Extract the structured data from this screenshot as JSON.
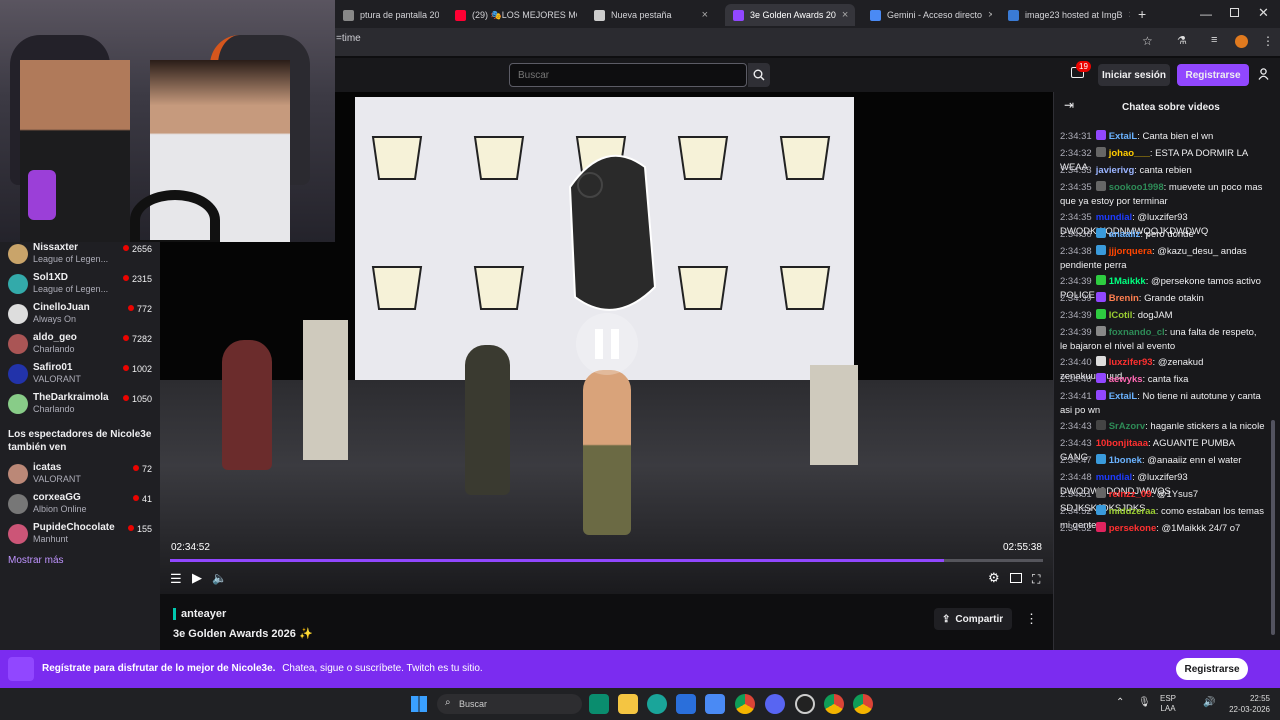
{
  "browser": {
    "tabs": [
      {
        "label": "ptura de pantalla 2026",
        "color": "#888"
      },
      {
        "label": "(29) 🎭LOS MEJORES MC",
        "color": "#ff0033"
      },
      {
        "label": "Nueva pestaña",
        "color": "#cccccc"
      },
      {
        "label": "3e Golden Awards 20",
        "color": "#9147ff"
      },
      {
        "label": "Gemini - Acceso directo",
        "color": "#4a8af4"
      },
      {
        "label": "image23 hosted at ImgB",
        "color": "#3a7bd5"
      }
    ],
    "address": "=time"
  },
  "header": {
    "search_placeholder": "Buscar",
    "notif_count": "19",
    "login_label": "Iniciar sesión",
    "signup_label": "Registrarse"
  },
  "sidebar": {
    "channels": [
      {
        "name": "Nissaxter",
        "game": "League of Legen...",
        "viewers": "2656",
        "color": "#c9a46a"
      },
      {
        "name": "Sol1XD",
        "game": "League of Legen...",
        "viewers": "2315",
        "color": "#3aa"
      },
      {
        "name": "CinelloJuan",
        "game": "Always On",
        "viewers": "772",
        "color": "#ddd"
      },
      {
        "name": "aldo_geo",
        "game": "Charlando",
        "viewers": "7282",
        "color": "#a55"
      },
      {
        "name": "Safiro01",
        "game": "VALORANT",
        "viewers": "1002",
        "color": "#2233aa"
      },
      {
        "name": "TheDarkraimola",
        "game": "Charlando",
        "viewers": "1050",
        "color": "#8c8"
      }
    ],
    "also_watch_title": "Los espectadores de Nicole3e también ven",
    "also_watch": [
      {
        "name": "icatas",
        "game": "VALORANT",
        "viewers": "72",
        "color": "#b87"
      },
      {
        "name": "corxeaGG",
        "game": "Albion Online",
        "viewers": "41",
        "color": "#777"
      },
      {
        "name": "PupideChocolate",
        "game": "Manhunt",
        "viewers": "155",
        "color": "#c57"
      }
    ],
    "show_more": "Mostrar más"
  },
  "player": {
    "time_current": "02:34:52",
    "time_total": "02:55:38",
    "progress": 0.887
  },
  "info": {
    "channel": "anteayer",
    "title": "3e Golden Awards 2026 ✨",
    "share_label": "Compartir"
  },
  "chat": {
    "title": "Chatea sobre videos",
    "messages": [
      {
        "time": "2:34:31",
        "user": "ExtaiL",
        "color": "#6bb3ff",
        "badge": "#9147ff",
        "text": "Canta bien el wn"
      },
      {
        "time": "2:34:32",
        "user": "johao___",
        "color": "#ffcc00",
        "badge": "#666",
        "text": "ESTA PA DORMIR LA WEAA"
      },
      {
        "time": "2:34:33",
        "user": "javierivg",
        "color": "#9ab4ff",
        "badge": "",
        "text": "canta rebien"
      },
      {
        "time": "2:34:35",
        "user": "sookoo1998",
        "color": "#2e8b57",
        "badge": "#666",
        "text": "muevete un poco mas que ya estoy por terminar"
      },
      {
        "time": "2:34:35",
        "user": "mundial",
        "color": "#1e3cff",
        "badge": "",
        "text": "@luxzifer93 DWQDKWQDNMWQOJKDWDWQ"
      },
      {
        "time": "2:34:36",
        "user": "anaaiiz",
        "color": "#6bb3ff",
        "badge": "#3a9bdc",
        "text": "pero donde"
      },
      {
        "time": "2:34:38",
        "user": "jjjorquera",
        "color": "#ff4500",
        "badge": "#3a9bdc",
        "text": "@kazu_desu_ andas pendiente perra"
      },
      {
        "time": "2:34:39",
        "user": "1Maikkk",
        "color": "#00ff7f",
        "badge": "#2ecc40",
        "text": "@persekone tamos activo POLICE"
      },
      {
        "time": "2:34:39",
        "user": "Brenin",
        "color": "#ff7f50",
        "badge": "#9147ff",
        "text": "Grande otakin"
      },
      {
        "time": "2:34:39",
        "user": "ICotil",
        "color": "#9acd32",
        "badge": "#2ecc40",
        "text": "dogJAM"
      },
      {
        "time": "2:34:39",
        "user": "foxnando_cl",
        "color": "#2e8b57",
        "badge": "#888",
        "text": "una falta de respeto, le bajaron el nivel al evento"
      },
      {
        "time": "2:34:40",
        "user": "luxzifer93",
        "color": "#ff3030",
        "badge": "#ddd",
        "text": "@zenakud zenakuuuuuud"
      },
      {
        "time": "2:34:40",
        "user": "aewyks",
        "color": "#ff69b4",
        "badge": "#9147ff",
        "text": "canta fixa"
      },
      {
        "time": "2:34:41",
        "user": "ExtaiL",
        "color": "#6bb3ff",
        "badge": "#9147ff",
        "text": "No tiene ni autotune y canta asi po wn"
      },
      {
        "time": "2:34:43",
        "user": "SrAzorv",
        "color": "#2e8b57",
        "badge": "#444",
        "text": "haganle stickers a la nicole"
      },
      {
        "time": "2:34:43",
        "user": "10bonjitaaa",
        "color": "#ff3030",
        "badge": "",
        "text": "AGUANTE PUMBA GANG"
      },
      {
        "time": "2:34:47",
        "user": "1bonek",
        "color": "#6bb3ff",
        "badge": "#3a9bdc",
        "text": "@anaaiiz enn el water"
      },
      {
        "time": "2:34:48",
        "user": "mundial",
        "color": "#1e3cff",
        "badge": "",
        "text": "@luxzifer93 DWQDWQDQNDJWWQS"
      },
      {
        "time": "2:34:51",
        "user": "reinzz_09",
        "color": "#ff3030",
        "badge": "#666",
        "text": "@1Ysus7 SDJKSKJDKSJDKS"
      },
      {
        "time": "2:34:52",
        "user": "middzeraa",
        "color": "#9acd32",
        "badge": "#3a9bdc",
        "text": "como estaban los temas mi gente"
      },
      {
        "time": "2:34:52",
        "user": "persekone",
        "color": "#ff3030",
        "badge": "#e0245e",
        "text": "@1Maikkk 24/7 o7"
      }
    ]
  },
  "banner": {
    "text_bold": "Regístrate para disfrutar de lo mejor de Nicole3e.",
    "text": "Chatea, sigue o suscríbete. Twitch es tu sitio.",
    "cta": "Registrarse"
  },
  "taskbar": {
    "search_placeholder": "Buscar",
    "lang": "ESP",
    "lang2": "LAA",
    "time": "22:55",
    "date": "22-03-2026"
  }
}
